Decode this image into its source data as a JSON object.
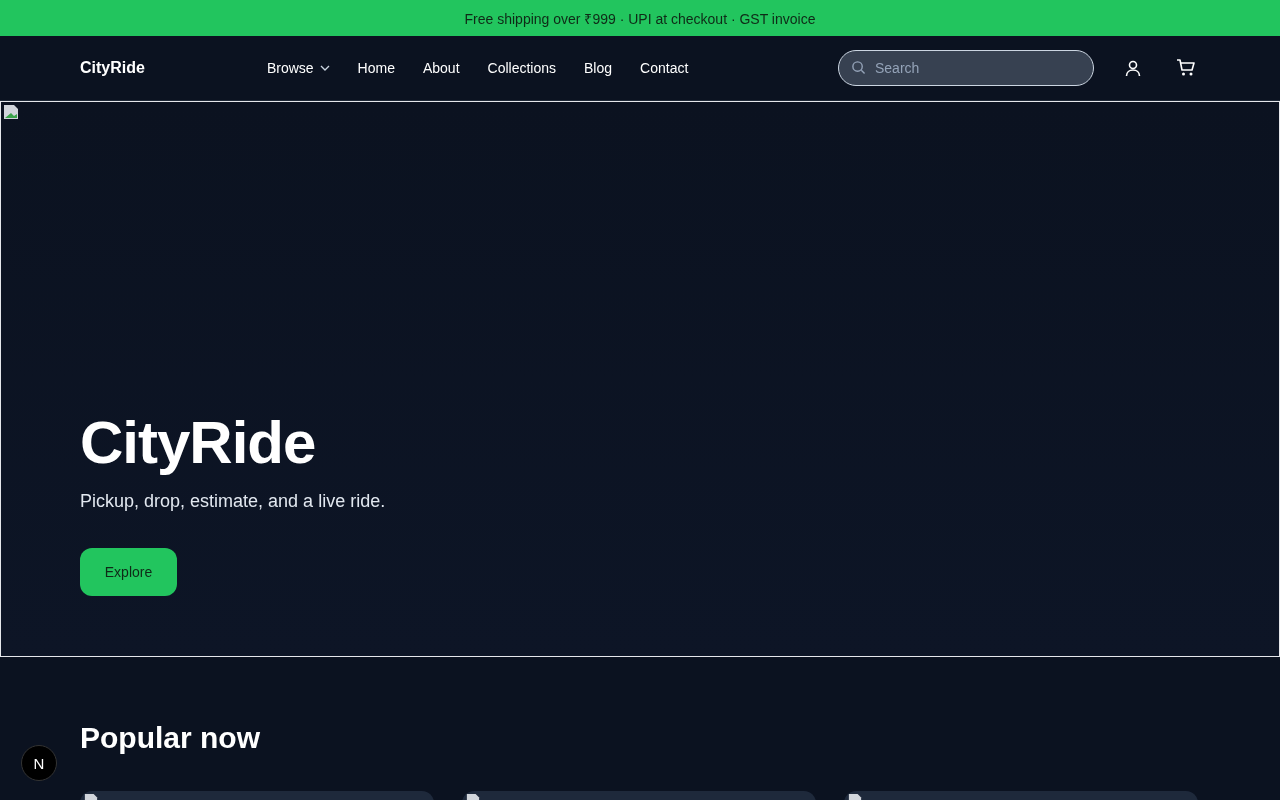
{
  "announcement": "Free shipping over ₹999 · UPI at checkout · GST invoice",
  "header": {
    "logo": "CityRide",
    "nav": [
      {
        "label": "Browse",
        "kind": "dropdown"
      },
      {
        "label": "Home",
        "kind": "link"
      },
      {
        "label": "About",
        "kind": "link"
      },
      {
        "label": "Collections",
        "kind": "link"
      },
      {
        "label": "Blog",
        "kind": "link"
      },
      {
        "label": "Contact",
        "kind": "link"
      }
    ],
    "search": {
      "placeholder": "Search"
    }
  },
  "hero": {
    "title": "CityRide",
    "subtitle": "Pickup, drop, estimate, and a live ride.",
    "button": "Explore"
  },
  "popular": {
    "title": "Popular now"
  },
  "badge": "N"
}
